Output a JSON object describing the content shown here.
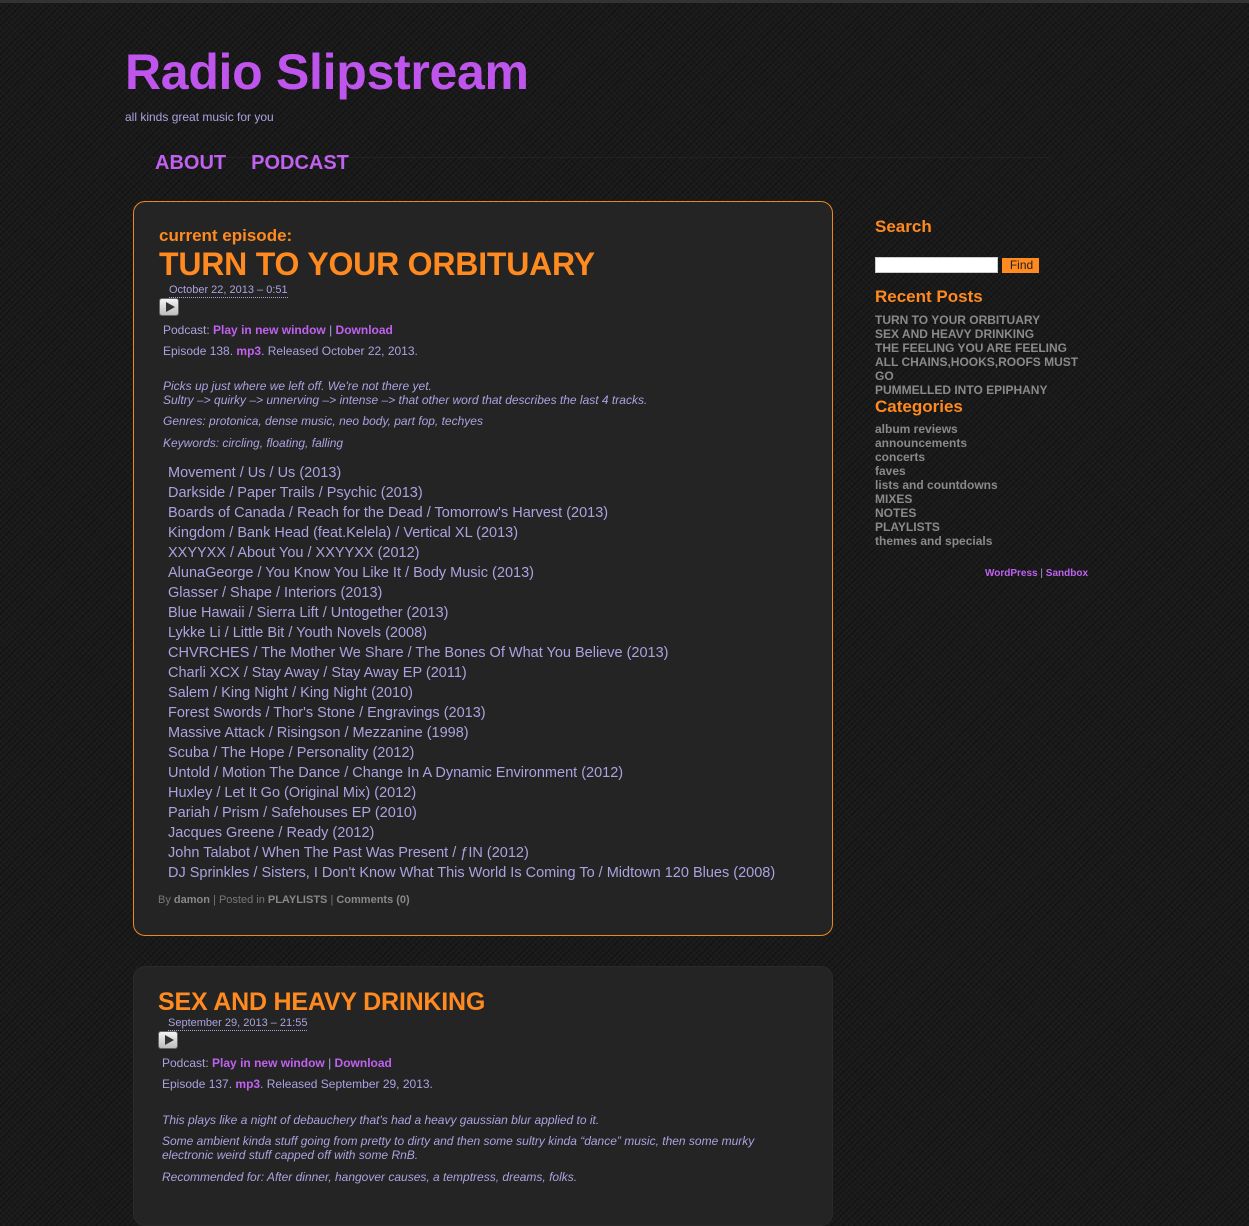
{
  "site": {
    "title": "Radio Slipstream",
    "tagline": "all kinds great music for you"
  },
  "nav": [
    {
      "label": "ABOUT"
    },
    {
      "label": "PODCAST"
    }
  ],
  "posts": [
    {
      "kicker": "current episode:",
      "title": "TURN TO YOUR ORBITUARY",
      "date": "October 22, 2013 – 0:51",
      "podcast_label": "Podcast:",
      "play_link": "Play in new window",
      "sep": "|",
      "download_link": "Download",
      "episode_prefix": "Episode 138.",
      "format": "mp3",
      "released": ". Released October 22, 2013.",
      "desc1": "Picks up just where we left off. We're not there yet.",
      "desc2": "Sultry –> quirky –> unnerving –> intense –> that other word that describes the last 4 tracks.",
      "genres": "Genres: protonica, dense music, neo body, part fop, techyes",
      "keywords": "Keywords: circling, floating, falling",
      "tracks": [
        "Movement / Us / Us (2013)",
        "Darkside / Paper Trails / Psychic (2013)",
        "Boards of Canada / Reach for the Dead / Tomorrow's Harvest (2013)",
        "Kingdom / Bank Head (feat.Kelela) / Vertical XL (2013)",
        "XXYYXX / About You / XXYYXX (2012)",
        "AlunaGeorge / You Know You Like It / Body Music (2013)",
        "Glasser / Shape / Interiors (2013)",
        "Blue Hawaii / Sierra Lift / Untogether (2013)",
        "Lykke Li / Little Bit / Youth Novels (2008)",
        "CHVRCHES / The Mother We Share / The Bones Of What You Believe (2013)",
        "Charli XCX / Stay Away / Stay Away EP (2011)",
        "Salem / King Night / King Night (2010)",
        "Forest Swords / Thor's Stone / Engravings (2013)",
        "Massive Attack / Risingson / Mezzanine (1998)",
        "Scuba / The Hope / Personality (2012)",
        "Untold / Motion The Dance / Change In A Dynamic Environment (2012)",
        "Huxley / Let It Go (Original Mix) (2012)",
        "Pariah / Prism / Safehouses EP (2010)",
        "Jacques Greene / Ready (2012)",
        "John Talabot / When The Past Was Present / ƒIN (2012)",
        "DJ Sprinkles / Sisters, I Don't Know What This World Is Coming To / Midtown 120 Blues (2008)"
      ],
      "by_label": "By",
      "author": "damon",
      "posted_in": "| Posted in",
      "category": "PLAYLISTS",
      "comments": "Comments (0)"
    },
    {
      "title": "SEX AND HEAVY DRINKING",
      "date": "September 29, 2013 – 21:55",
      "podcast_label": "Podcast:",
      "play_link": "Play in new window",
      "sep": "|",
      "download_link": "Download",
      "episode_prefix": "Episode 137.",
      "format": "mp3",
      "released": ". Released September 29, 2013.",
      "desc1": "This plays like a night of debauchery that's had a heavy gaussian blur applied to it.",
      "desc2": "Some ambient kinda stuff going from pretty to dirty and then some sultry kinda “dance” music, then some murky electronic weird stuff capped off with some RnB.",
      "desc3": "Recommended for: After dinner, hangover causes, a temptress, dreams, folks."
    }
  ],
  "sidebar": {
    "search_heading": "Search",
    "find_label": "Find",
    "recent_heading": "Recent Posts",
    "recent": [
      "TURN TO YOUR ORBITUARY",
      "SEX AND HEAVY DRINKING",
      "THE FEELING YOU ARE FEELING",
      "ALL CHAINS,HOOKS,ROOFS MUST GO",
      "PUMMELLED INTO EPIPHANY"
    ],
    "categories_heading": "Categories",
    "categories": [
      "album reviews",
      "announcements",
      "concerts",
      "faves",
      "lists and countdowns",
      "MIXES",
      "NOTES",
      "PLAYLISTS",
      "themes and specials"
    ],
    "credit1": "WordPress",
    "credit_sep": "|",
    "credit2": "Sandbox"
  },
  "colors": {
    "background": "#1a1a1a",
    "title_purple": "#bf55ec",
    "accent_orange": "#ff8a1f",
    "text_lavender": "#a9a3e0"
  }
}
